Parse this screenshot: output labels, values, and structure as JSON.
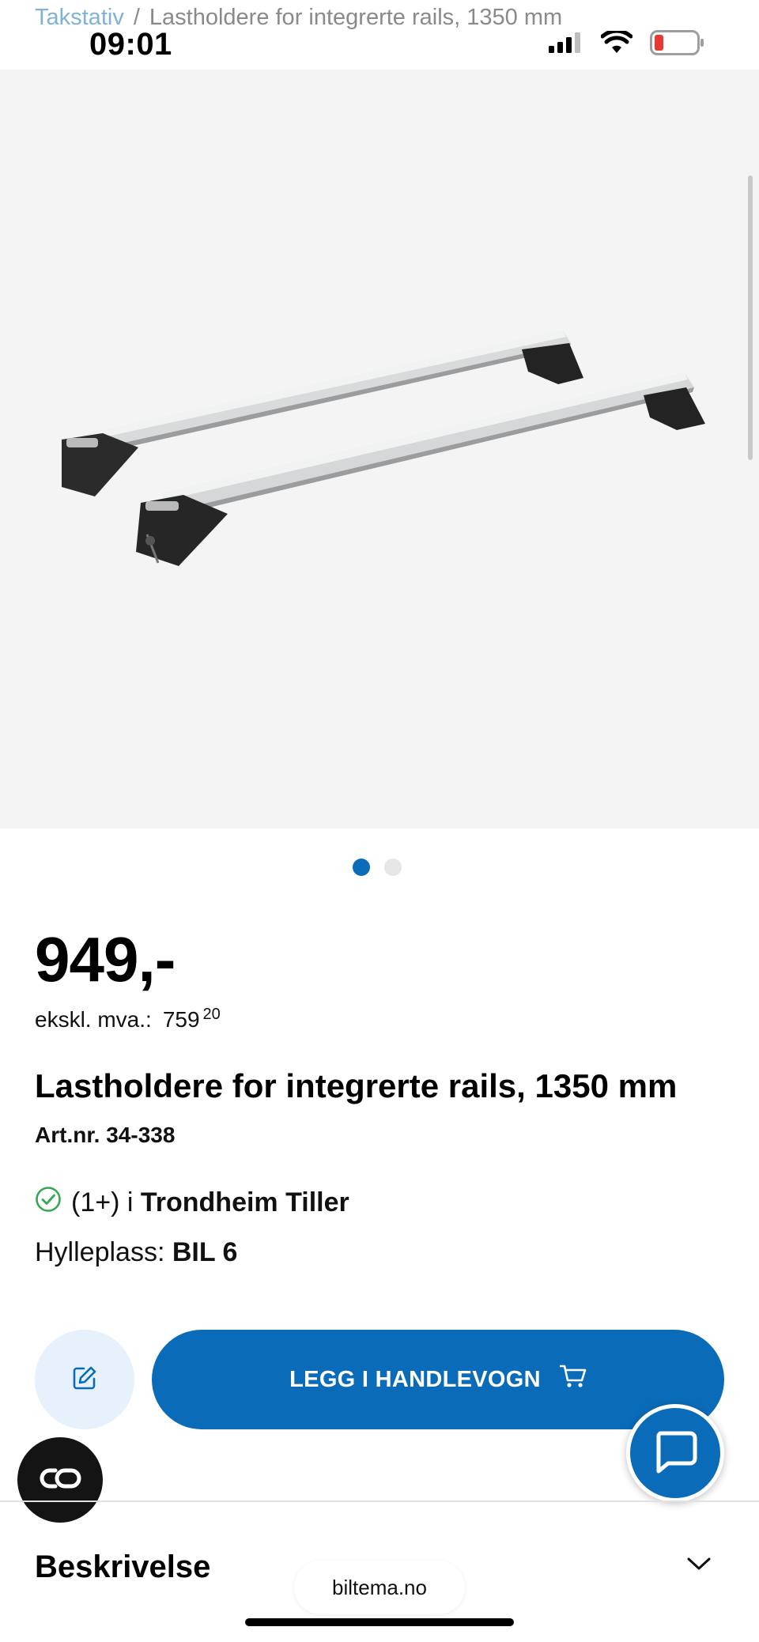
{
  "breadcrumb": {
    "parent": "Takstativ",
    "separator": "/",
    "current": "Lastholdere for integrerte rails, 1350 mm"
  },
  "status_bar": {
    "time": "09:01",
    "icons": [
      "cellular-signal-icon",
      "wifi-icon",
      "battery-low-icon"
    ],
    "battery_color": "#e53935"
  },
  "gallery": {
    "image_alt": "roof-rack-crossbars",
    "pages": 2,
    "active_page": 1,
    "active_color": "#0a6cb8"
  },
  "product": {
    "price": "949,-",
    "ex_vat_label": "ekskl. mva.:",
    "ex_vat_amount": "759",
    "ex_vat_decimals": "20",
    "title": "Lastholdere for integrerte rails, 1350 mm",
    "art_nr": "Art.nr. 34-338",
    "stock_count": "(1+) i",
    "store": "Trondheim Tiller",
    "shelf_label": "Hylleplass:",
    "shelf_value": "BIL 6"
  },
  "actions": {
    "add_to_cart": "LEGG I HANDLEVOGN",
    "edit_icon": "edit-note-icon",
    "cart_icon": "cart-icon",
    "chat_icon": "chat-bubble-icon",
    "cookie_icon": "cookie-settings-icon"
  },
  "sections": {
    "description": "Beskrivelse"
  },
  "browser": {
    "url": "biltema.no"
  },
  "colors": {
    "brand_blue": "#0a6cb8",
    "light_blue": "#e6f1fb",
    "in_stock_green": "#3aa655"
  }
}
